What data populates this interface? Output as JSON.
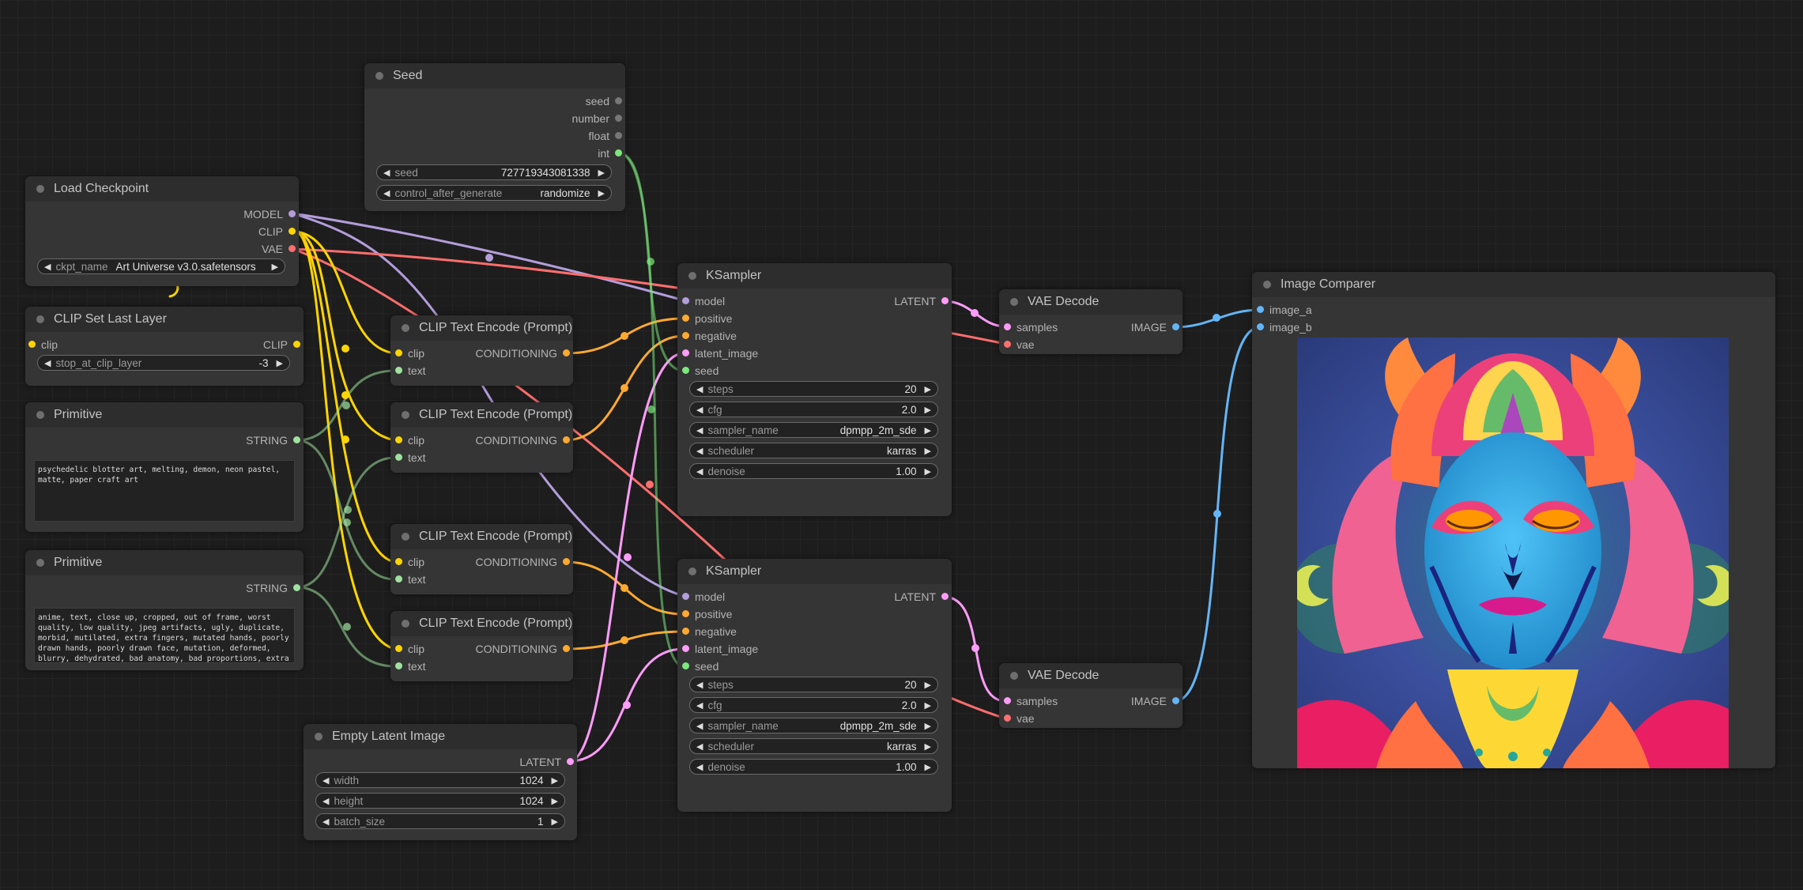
{
  "nodes": {
    "seed": {
      "title": "Seed",
      "outputs": [
        "seed",
        "number",
        "float",
        "int"
      ],
      "widgets": [
        {
          "label": "seed",
          "value": "727719343081338"
        },
        {
          "label": "control_after_generate",
          "value": "randomize"
        }
      ]
    },
    "load_checkpoint": {
      "title": "Load Checkpoint",
      "outputs": [
        "MODEL",
        "CLIP",
        "VAE"
      ],
      "widgets": [
        {
          "label": "ckpt_name",
          "value": "Art Universe v3.0.safetensors"
        }
      ]
    },
    "clip_set_last_layer": {
      "title": "CLIP Set Last Layer",
      "input": "clip",
      "output": "CLIP",
      "widgets": [
        {
          "label": "stop_at_clip_layer",
          "value": "-3"
        }
      ]
    },
    "primitive_1": {
      "title": "Primitive",
      "output": "STRING",
      "text": "psychedelic blotter art, melting, demon, neon pastel, matte, paper craft art"
    },
    "primitive_2": {
      "title": "Primitive",
      "output": "STRING",
      "text": "anime, text, close up, cropped, out of frame, worst quality, low quality, jpeg artifacts, ugly, duplicate, morbid, mutilated, extra fingers, mutated hands, poorly drawn hands, poorly drawn face, mutation, deformed, blurry, dehydrated, bad anatomy, bad proportions, extra limbs,"
    },
    "clip_encode": {
      "title": "CLIP Text Encode (Prompt)",
      "inputs": [
        "clip",
        "text"
      ],
      "output": "CONDITIONING"
    },
    "empty_latent": {
      "title": "Empty Latent Image",
      "output": "LATENT",
      "widgets": [
        {
          "label": "width",
          "value": "1024"
        },
        {
          "label": "height",
          "value": "1024"
        },
        {
          "label": "batch_size",
          "value": "1"
        }
      ]
    },
    "ksampler": {
      "title": "KSampler",
      "inputs": [
        "model",
        "positive",
        "negative",
        "latent_image",
        "seed"
      ],
      "output": "LATENT",
      "widgets": [
        {
          "label": "steps",
          "value": "20"
        },
        {
          "label": "cfg",
          "value": "2.0"
        },
        {
          "label": "sampler_name",
          "value": "dpmpp_2m_sde"
        },
        {
          "label": "scheduler",
          "value": "karras"
        },
        {
          "label": "denoise",
          "value": "1.00"
        }
      ]
    },
    "vae_decode": {
      "title": "VAE Decode",
      "inputs": [
        "samples",
        "vae"
      ],
      "output": "IMAGE"
    },
    "image_comparer": {
      "title": "Image Comparer",
      "inputs": [
        "image_a",
        "image_b"
      ]
    }
  },
  "colors": {
    "model": "#b39ddb",
    "clip": "#ffd500",
    "vae": "#ff6e6e",
    "conditioning": "#ffa931",
    "latent": "#ff9cf9",
    "int": "#7ce87c",
    "string": "#9fe29f",
    "image": "#64b5f6",
    "canvas": "#1d1d1d",
    "node": "#353535"
  },
  "icons": {
    "arrow_left": "◀",
    "arrow_right": "▶"
  }
}
